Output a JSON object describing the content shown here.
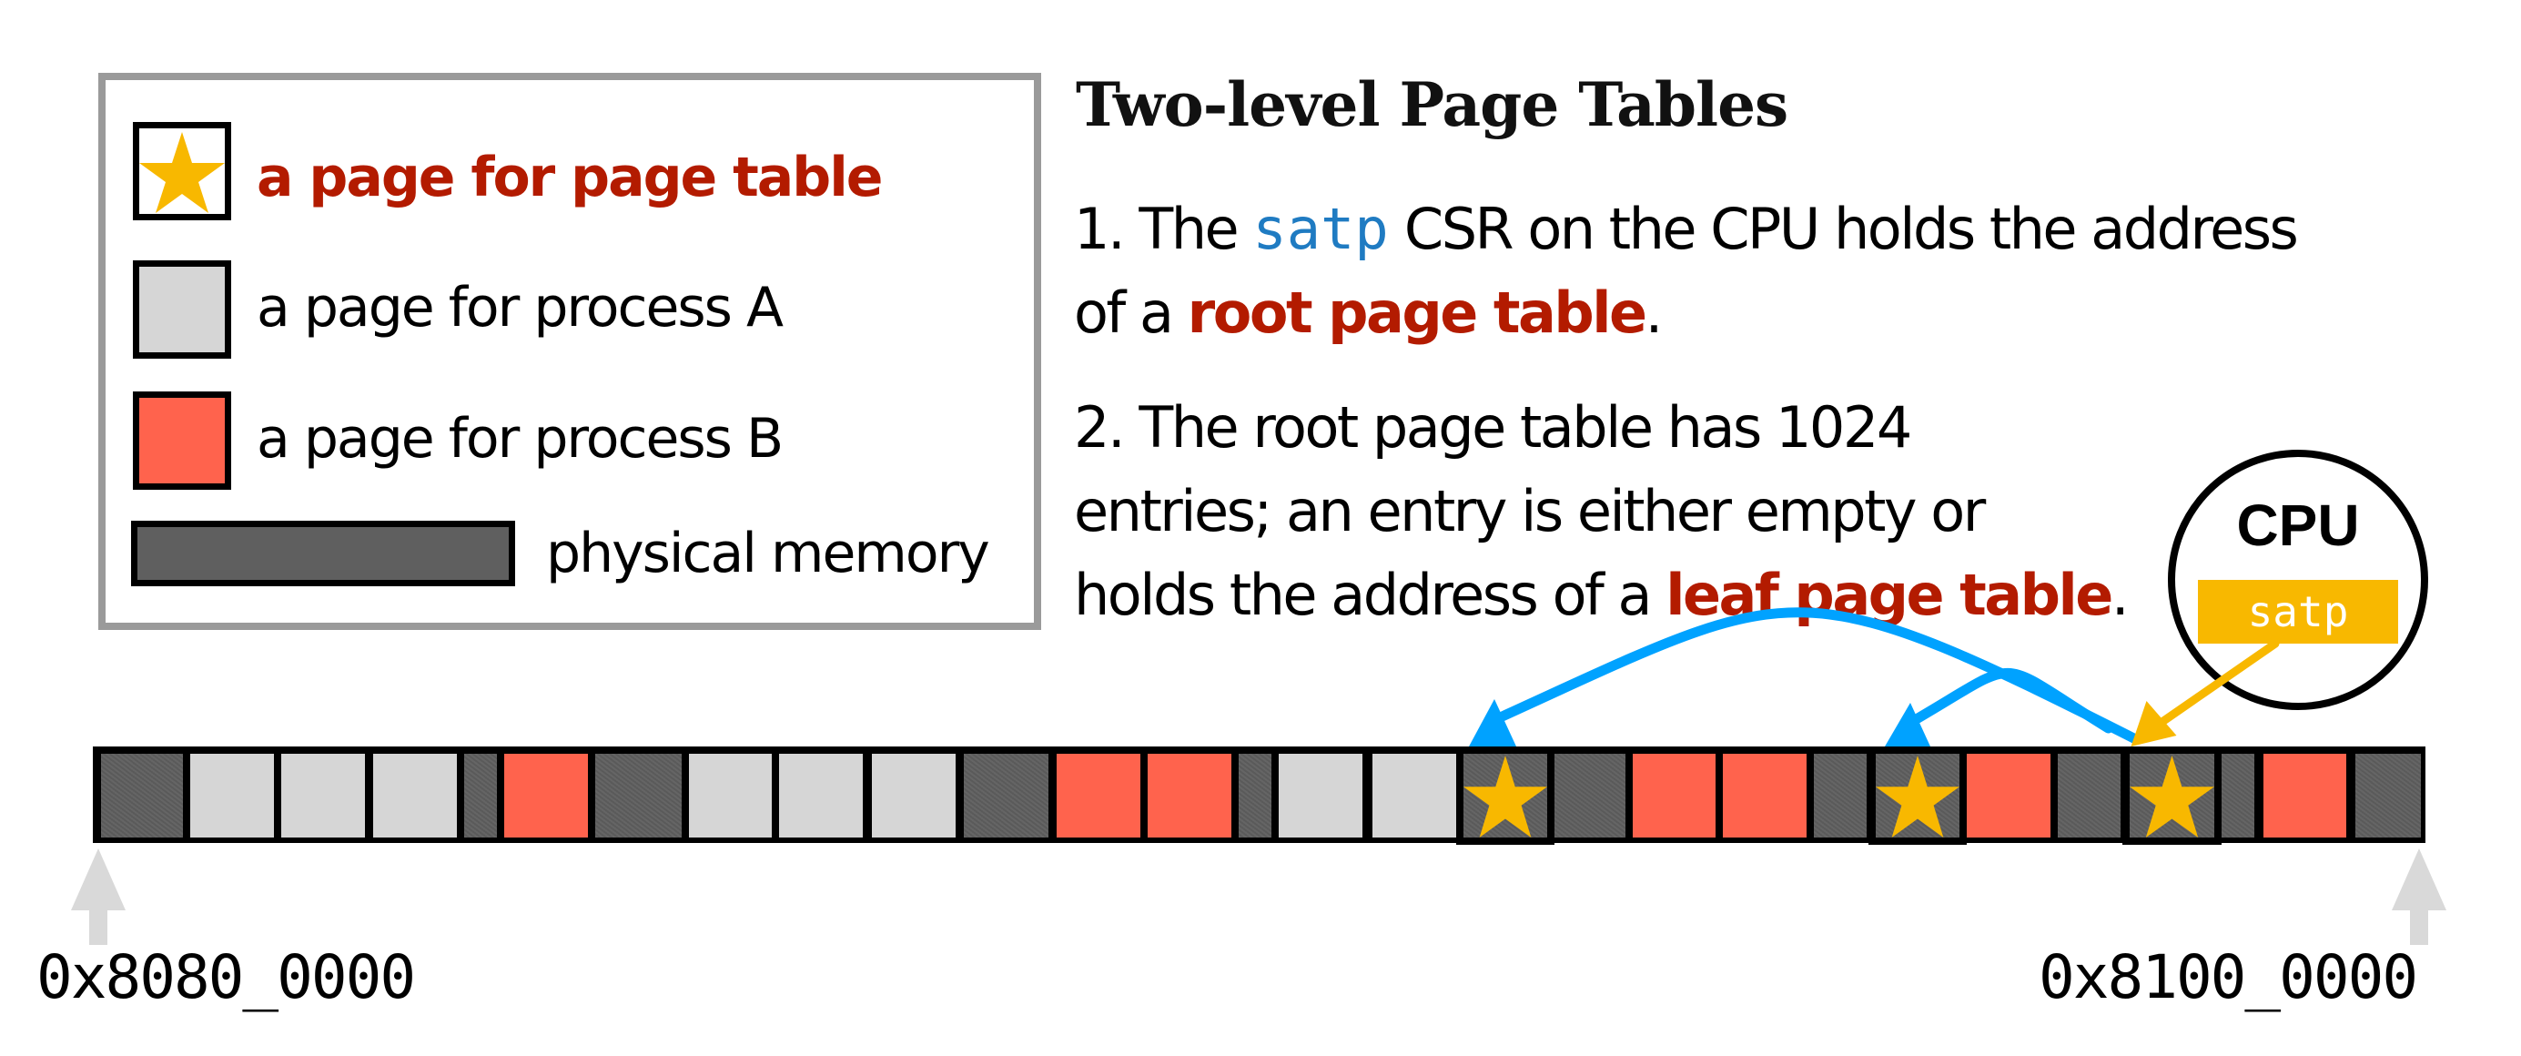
{
  "legend": {
    "items": [
      {
        "label": "a page for page table",
        "kind": "page-table",
        "highlight": true
      },
      {
        "label": "a page for process A",
        "kind": "procA"
      },
      {
        "label": "a page for process B",
        "kind": "procB"
      },
      {
        "label": "physical memory",
        "kind": "memory"
      }
    ]
  },
  "title": "Two-level Page Tables",
  "para1": {
    "prefix": "1. The ",
    "code": "satp",
    "middle": " CSR on the CPU holds the address",
    "line2_prefix": "of a ",
    "highlight": "root page table",
    "suffix": "."
  },
  "para2": {
    "line1": "2. The root page table has 1024",
    "line2": "entries; an entry is either empty or",
    "line3_prefix": "holds the address of a ",
    "highlight": "leaf page table",
    "suffix": "."
  },
  "cpu": {
    "label": "CPU",
    "register": "satp"
  },
  "memory": {
    "start_address": "0x8080_0000",
    "end_address": "0x8100_0000",
    "segments": [
      "gray",
      "procA",
      "procA",
      "procA",
      "gray",
      "procB",
      "gray",
      "procA",
      "procA",
      "procA",
      "gray",
      "procB",
      "procB",
      "gray",
      "procA",
      "procA",
      "pagetable",
      "gray",
      "procB",
      "procB",
      "gray",
      "pagetable",
      "procB",
      "gray",
      "pagetable",
      "gray",
      "procB",
      "gray"
    ],
    "root_page_table_index": 2,
    "leaf_page_table_indices": [
      0,
      1
    ]
  },
  "colors": {
    "highlight_red": "#b31b00",
    "code_blue": "#1f7bc2",
    "star_yellow": "#f8b800",
    "arrow_blue": "#00a2ff",
    "procA": "#d6d6d6",
    "procB": "#ff634d",
    "memory_gray": "#5f5f5f"
  }
}
